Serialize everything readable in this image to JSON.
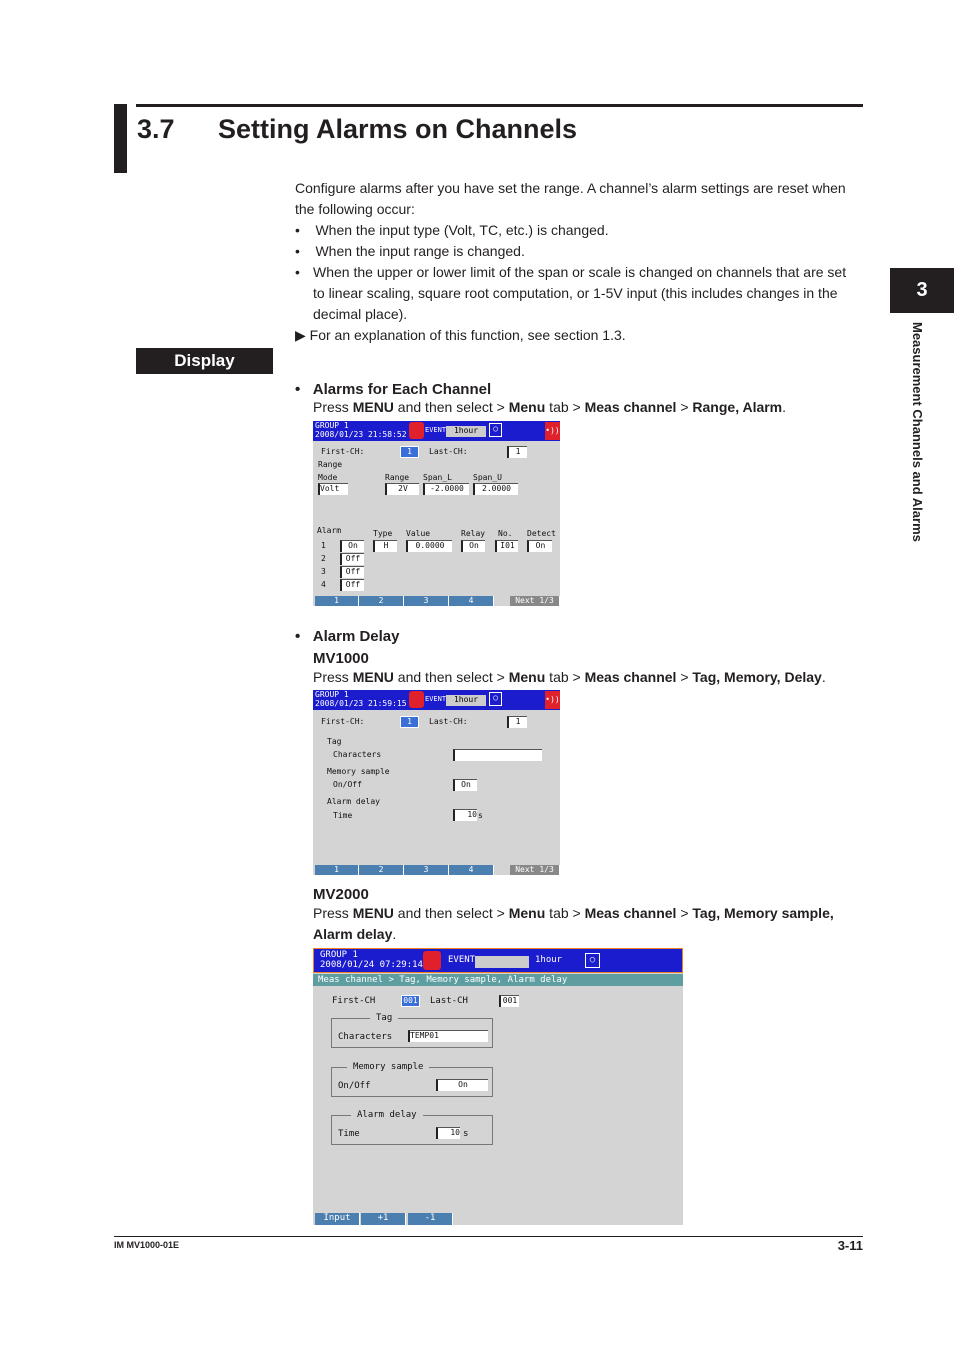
{
  "section": {
    "number": "3.7",
    "title": "Setting Alarms on Channels"
  },
  "side_tab": {
    "number": "3",
    "label": "Measurement Channels and Alarms"
  },
  "intro": {
    "text1": "Configure alarms after you have set the range. A channel’s alarm settings are reset when",
    "text2": "the following occur:",
    "bullets": [
      "When the input type (Volt, TC, etc.) is changed.",
      "When the input range is changed."
    ],
    "bullet3": [
      "When the upper or lower limit of the span or scale is changed on channels that are set",
      "to linear scaling, square root computation, or 1-5V input (this includes changes in the",
      "decimal place)."
    ],
    "ref": "For an explanation of this function, see section 1.3."
  },
  "display_label": "Display",
  "alarms_each": {
    "heading": "Alarms for Each Channel",
    "p1": "Press ",
    "menu": "MENU",
    "p2": " and then select > ",
    "menu_tab": "Menu",
    "p3": " tab > ",
    "meas": "Meas channel",
    "p4": " > ",
    "target": "Range, Alarm",
    "p5": "."
  },
  "alarm_delay": {
    "heading": "Alarm Delay",
    "mv1000": "MV1000",
    "mv1000_target": "Tag, Memory, Delay",
    "mv2000": "MV2000",
    "mv2000_target1": "Tag, Memory sample,",
    "mv2000_target2": "Alarm delay"
  },
  "screen1": {
    "group": "GROUP 1",
    "datetime": "2008/01/23 21:58:52",
    "event": "EVENT",
    "period": "1hour",
    "first_ch_label": "First-CH:",
    "first_ch": "1",
    "last_ch_label": "Last-CH:",
    "last_ch": "1",
    "range": "Range",
    "mode_label": "Mode",
    "mode": "Volt",
    "range_label": "Range",
    "range_val": "2V",
    "span_l_label": "Span_L",
    "span_l": "-2.0000",
    "span_u_label": "Span_U",
    "span_u": "2.0000",
    "alarm_label": "Alarm",
    "type_label": "Type",
    "value_label": "Value",
    "relay_label": "Relay",
    "no_label": "No.",
    "detect_label": "Detect",
    "alarms": [
      {
        "n": "1",
        "state": "On",
        "type": "H",
        "value": "0.0000",
        "relay": "On",
        "no": "I01",
        "detect": "On"
      },
      {
        "n": "2",
        "state": "Off"
      },
      {
        "n": "3",
        "state": "Off"
      },
      {
        "n": "4",
        "state": "Off"
      }
    ],
    "softkeys": [
      "1",
      "2",
      "3",
      "4"
    ],
    "next": "Next 1/3"
  },
  "screen2": {
    "group": "GROUP 1",
    "datetime": "2008/01/23 21:59:15",
    "event": "EVENT",
    "period": "1hour",
    "first_ch_label": "First-CH:",
    "first_ch": "1",
    "last_ch_label": "Last-CH:",
    "last_ch": "1",
    "tag": "Tag",
    "characters": "Characters",
    "characters_val": "",
    "memory": "Memory sample",
    "onoff": "On/Off",
    "onoff_val": "On",
    "delay": "Alarm delay",
    "time": "Time",
    "time_val": "10",
    "unit": "s",
    "softkeys": [
      "1",
      "2",
      "3",
      "4"
    ],
    "next": "Next 1/3"
  },
  "screen3": {
    "group": "GROUP 1",
    "datetime": "2008/01/24 07:29:14",
    "event": "EVENT",
    "period": "1hour",
    "breadcrumb": "Meas channel > Tag, Memory sample, Alarm delay",
    "first_ch_label": "First-CH",
    "first_ch": "001",
    "last_ch_label": "Last-CH",
    "last_ch": "001",
    "tag": "Tag",
    "characters": "Characters",
    "characters_val": "TEMP01",
    "memory": "Memory sample",
    "onoff": "On/Off",
    "onoff_val": "On",
    "delay": "Alarm delay",
    "time": "Time",
    "time_val": "10",
    "unit": "s",
    "softkeys": [
      "Input",
      "+1",
      "-1"
    ]
  },
  "footer": {
    "doc": "IM MV1000-01E",
    "page": "3-11"
  },
  "colors": {
    "screen_header": "#1c1ccf",
    "softkey": "#4a7fb0",
    "breadcrumb_bar": "#5f9ea0"
  }
}
